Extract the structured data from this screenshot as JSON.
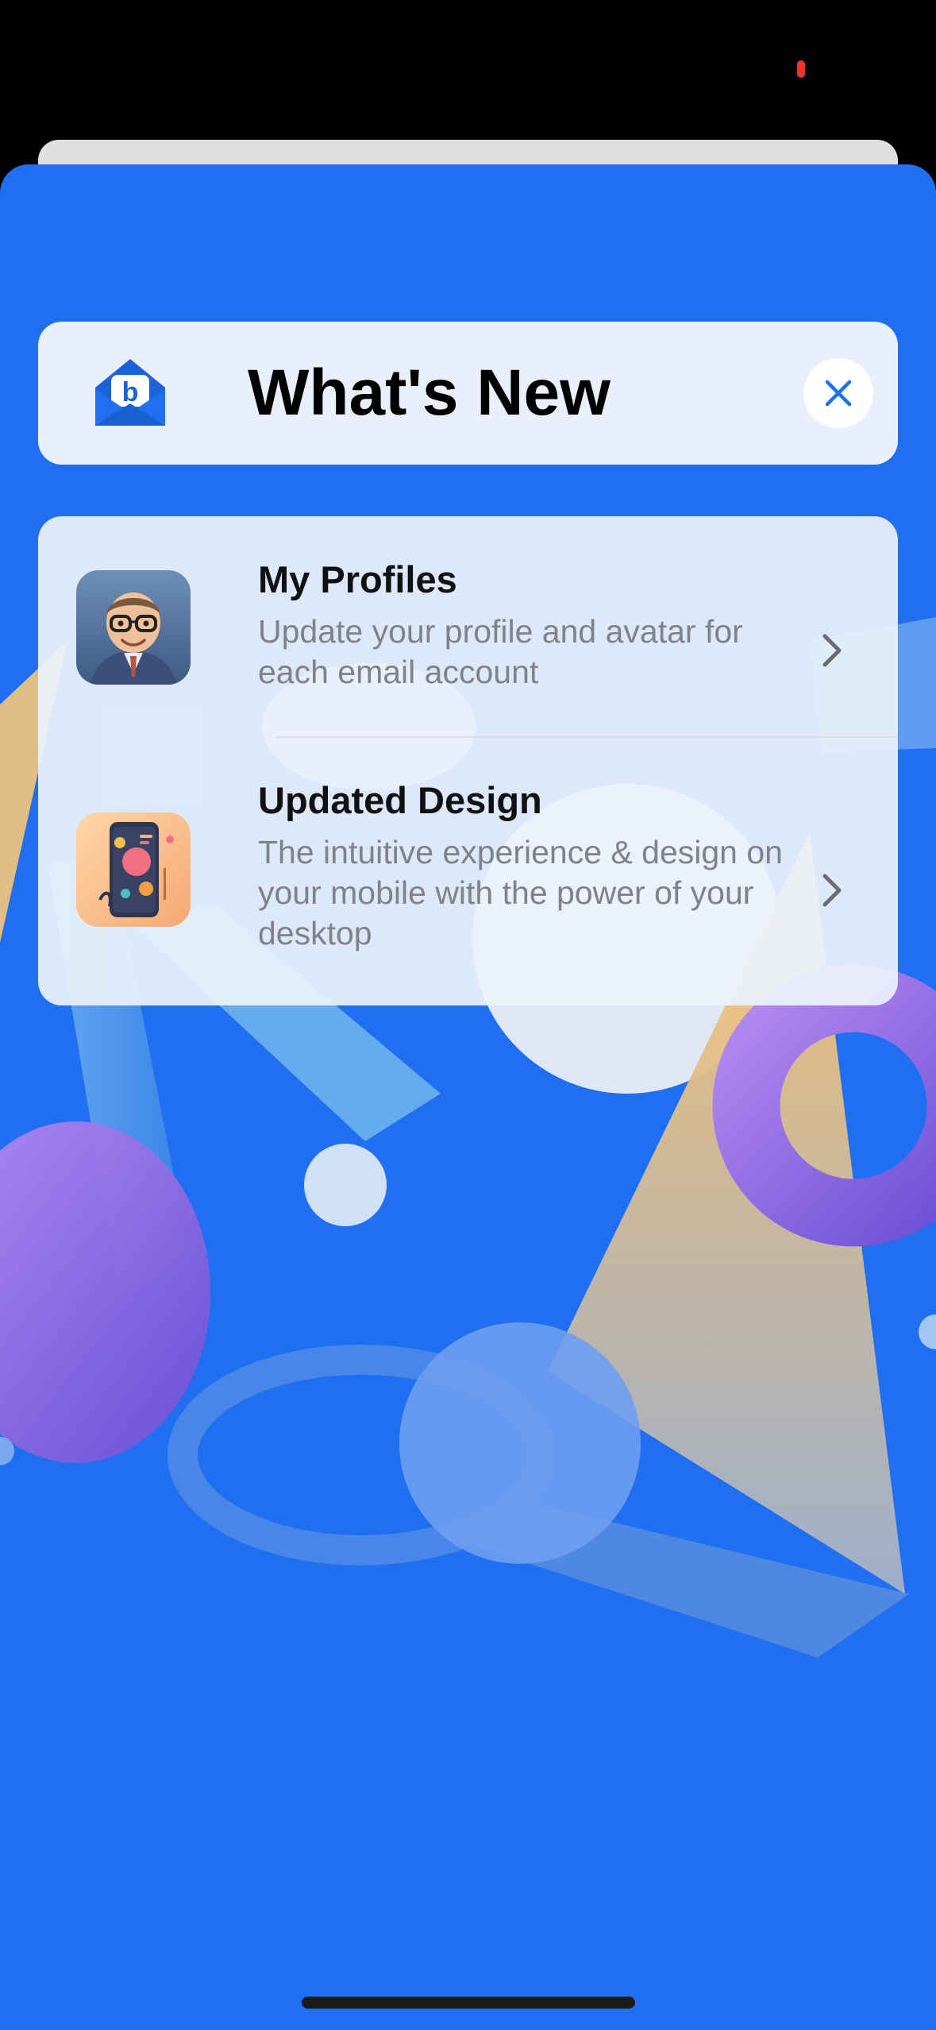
{
  "colors": {
    "sheet_background": "#1f6ff0",
    "card_background": "#eaf0fb",
    "accent": "#1f6ff0",
    "close_icon": "#1a73e8"
  },
  "header": {
    "title": "What's New",
    "logo_icon": "mail-envelope-b-logo-icon",
    "close_icon": "close-icon"
  },
  "features": [
    {
      "title": "My Profiles",
      "subtitle": "Update your profile and avatar for each email account",
      "icon": "profile-avatar-thumbnail",
      "chevron": "chevron-right-icon"
    },
    {
      "title": "Updated Design",
      "subtitle": "The intuitive experience & design on your mobile with the power of your desktop",
      "icon": "phone-design-thumbnail",
      "chevron": "chevron-right-icon"
    }
  ]
}
